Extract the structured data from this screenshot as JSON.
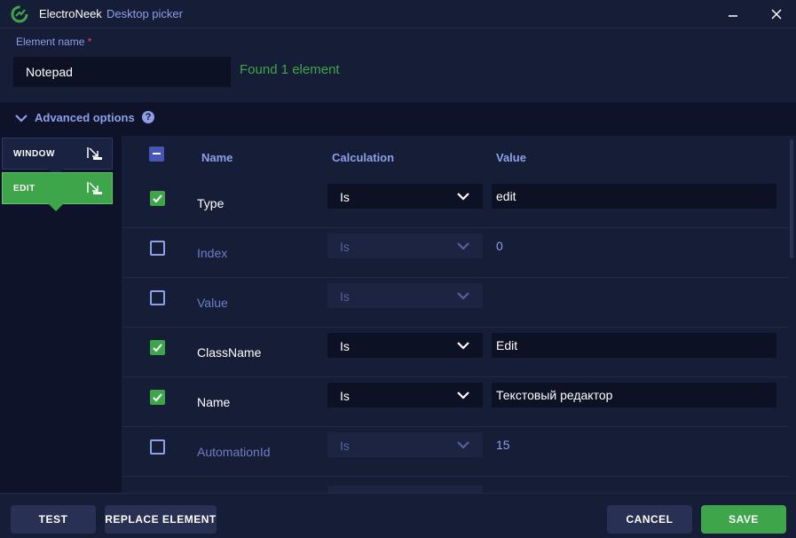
{
  "window": {
    "app_name": "ElectroNeek",
    "subtitle": "Desktop picker",
    "icons": {
      "logo": "electroneek-logo-icon",
      "minimize": "minimize-icon",
      "close": "close-icon"
    }
  },
  "element_name": {
    "label": "Element name",
    "required_mark": "*",
    "value": "Notepad",
    "status": "Found 1 element"
  },
  "advanced": {
    "label": "Advanced options",
    "help": "?",
    "expanded": true
  },
  "tree": {
    "nodes": [
      {
        "label": "WINDOW",
        "selected": false,
        "icon": "pick-element-icon"
      },
      {
        "label": "EDIT",
        "selected": true,
        "icon": "pick-element-icon"
      }
    ]
  },
  "table": {
    "headers": {
      "name": "Name",
      "calculation": "Calculation",
      "value": "Value"
    },
    "header_checkbox_state": "indeterminate",
    "rows": [
      {
        "checked": true,
        "name": "Type",
        "calc": "Is",
        "value": "edit"
      },
      {
        "checked": false,
        "name": "Index",
        "calc": "Is",
        "value": "0"
      },
      {
        "checked": false,
        "name": "Value",
        "calc": "Is",
        "value": ""
      },
      {
        "checked": true,
        "name": "ClassName",
        "calc": "Is",
        "value": "Edit"
      },
      {
        "checked": true,
        "name": "Name",
        "calc": "Is",
        "value": "Текстовый редактор"
      },
      {
        "checked": false,
        "name": "AutomationId",
        "calc": "Is",
        "value": "15"
      }
    ]
  },
  "footer": {
    "test": "TEST",
    "replace": "REPLACE ELEMENT",
    "cancel": "CANCEL",
    "save": "SAVE"
  },
  "colors": {
    "background": "#161d36",
    "panel_dark": "#0e1329",
    "accent_green": "#3fa54a",
    "accent_blue": "#8d9fe8",
    "required_red": "#e0475c"
  }
}
